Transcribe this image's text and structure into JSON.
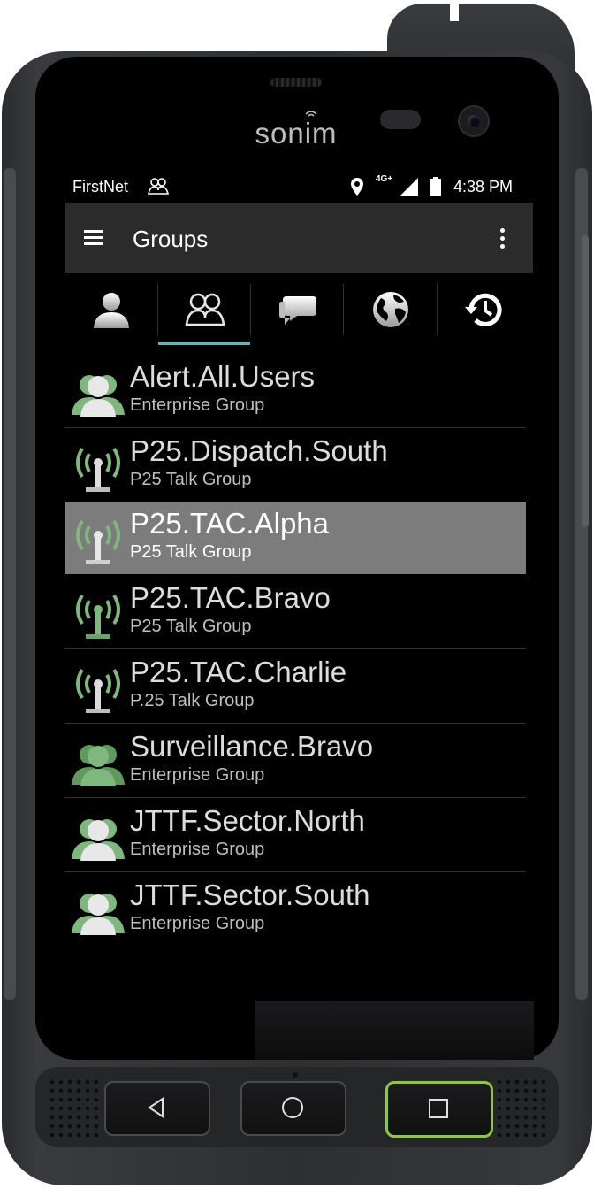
{
  "device": {
    "brand": "sonim"
  },
  "status_bar": {
    "carrier": "FirstNet",
    "network": "4G+",
    "time": "4:38 PM"
  },
  "app_bar": {
    "title": "Groups"
  },
  "tabs": [
    {
      "icon": "contact-icon",
      "selected": false
    },
    {
      "icon": "group-icon",
      "selected": true
    },
    {
      "icon": "chat-icon",
      "selected": false
    },
    {
      "icon": "globe-icon",
      "selected": false
    },
    {
      "icon": "history-icon",
      "selected": false
    }
  ],
  "groups": [
    {
      "name": "Alert.All.Users",
      "type": "Enterprise Group",
      "icon": "group-icon",
      "selected": false
    },
    {
      "name": "P25.Dispatch.South",
      "type": "P25 Talk Group",
      "icon": "radio-tower-icon",
      "selected": false
    },
    {
      "name": "P25.TAC.Alpha",
      "type": "P25 Talk Group",
      "icon": "radio-tower-icon",
      "selected": true
    },
    {
      "name": "P25.TAC.Bravo",
      "type": "P25 Talk Group",
      "icon": "radio-tower-icon",
      "selected": false
    },
    {
      "name": "P25.TAC.Charlie",
      "type": "P.25 Talk Group",
      "icon": "radio-tower-icon",
      "selected": false
    },
    {
      "name": "Surveillance.Bravo",
      "type": "Enterprise Group",
      "icon": "group-icon",
      "selected": false
    },
    {
      "name": "JTTF.Sector.North",
      "type": "Enterprise Group",
      "icon": "group-icon",
      "selected": false
    },
    {
      "name": "JTTF.Sector.South",
      "type": "Enterprise Group",
      "icon": "group-icon",
      "selected": false
    }
  ],
  "nav_buttons": [
    {
      "icon": "back-icon"
    },
    {
      "icon": "home-icon"
    },
    {
      "icon": "recents-icon"
    }
  ],
  "colors": {
    "accent_underline": "#5fb8b6",
    "icon_green": "#7fb77e",
    "selected_row": "#7c7c7c",
    "recents_button_border": "#8dc63f"
  }
}
